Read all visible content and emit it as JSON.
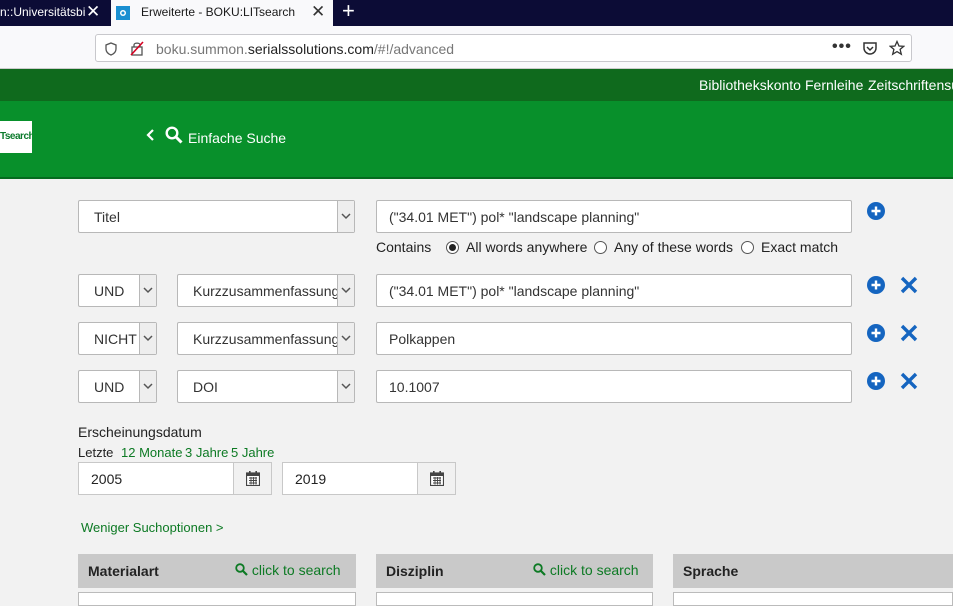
{
  "browser": {
    "tabs": [
      {
        "label": "n::Universitätsbi"
      },
      {
        "label": "Erweiterte - BOKU:LITsearch"
      }
    ],
    "url_prefix": "boku.summon.",
    "url_domain": "serialssolutions.com",
    "url_path": "/#!/advanced"
  },
  "topnav": {
    "items": [
      "Bibliothekskonto",
      "Fernleihe",
      "Zeitschriftensu"
    ]
  },
  "header": {
    "logo_text": "Tsearch",
    "simple_search_label": "Einfache Suche"
  },
  "search": {
    "row1": {
      "field": "Titel",
      "query": "(\"34.01 MET\") pol* \"landscape planning\""
    },
    "contains_label": "Contains",
    "match_options": [
      {
        "label": "All words anywhere",
        "selected": true
      },
      {
        "label": "Any of these words",
        "selected": false
      },
      {
        "label": "Exact match",
        "selected": false
      }
    ],
    "rows": [
      {
        "operator": "UND",
        "field": "Kurzzusammenfassung",
        "query": "(\"34.01 MET\") pol* \"landscape planning\""
      },
      {
        "operator": "NICHT",
        "field": "Kurzzusammenfassung",
        "query": "Polkappen"
      },
      {
        "operator": "UND",
        "field": "DOI",
        "query": "10.1007"
      }
    ]
  },
  "date": {
    "heading": "Erscheinungsdatum",
    "last_label": "Letzte",
    "quick_links": [
      "12 Monate",
      "3 Jahre",
      "5 Jahre"
    ],
    "from": "2005",
    "to": "2019"
  },
  "less_options_label": "Weniger Suchoptionen >",
  "facets": [
    {
      "title": "Materialart",
      "search_label": "click to search"
    },
    {
      "title": "Disziplin",
      "search_label": "click to search"
    },
    {
      "title": "Sprache",
      "search_label": ""
    }
  ],
  "colors": {
    "brand_green": "#08902b",
    "dark_green": "#0f6a1d",
    "link_blue": "#1565c0"
  }
}
